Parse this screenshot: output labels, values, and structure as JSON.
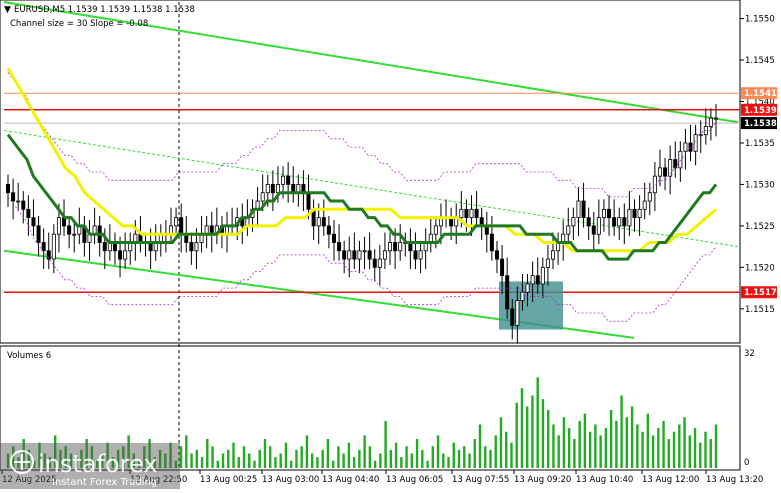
{
  "header": {
    "symbol_line": "EURUSD,M5  1.1539 1.1539 1.1538 1.1538",
    "indicator_line": "Channel size = 30 Slope = -0.08"
  },
  "volumes_panel": {
    "label": "Volumes 6",
    "scale_top": "32",
    "scale_bottom": "0"
  },
  "watermark": {
    "brand": "instaforex",
    "tagline": "Instant Forex Trading"
  },
  "colors": {
    "channel": "#33dd33",
    "level": "#ee1111",
    "level_light": "#ff8855",
    "ma_fast": "#1f7a1f",
    "ma_slow": "#f2f200",
    "envelope": "#aa33cc",
    "candle": "#000000",
    "volume": "#22aa22",
    "highlight": "#3f8f8f"
  },
  "chart_data": {
    "type": "candlestick",
    "symbol": "EURUSD",
    "timeframe": "M5",
    "ylim": [
      1.1511,
      1.1552
    ],
    "y_ticks": [
      "1.1550",
      "1.1545",
      "1.1540",
      "1.1535",
      "1.1530",
      "1.1525",
      "1.1520",
      "1.1515"
    ],
    "x_ticks": [
      "12 Aug 2025",
      "12 Aug 22:50",
      "13 Aug 00:25",
      "13 Aug 03:00",
      "13 Aug 04:40",
      "13 Aug 06:05",
      "13 Aug 07:55",
      "13 Aug 09:20",
      "13 Aug 10:40",
      "13 Aug 12:00",
      "13 Aug 13:20"
    ],
    "levels": [
      {
        "value": 1.1541,
        "label": "1.1541",
        "style": "light"
      },
      {
        "value": 1.1539,
        "label": "1.1539",
        "style": "strong"
      },
      {
        "value": 1.1517,
        "label": "1.1517",
        "style": "strong"
      }
    ],
    "current_price": {
      "value": 1.1538,
      "label": "1.1538"
    },
    "close": [
      1.1529,
      1.1528,
      1.1528,
      1.1527,
      1.1526,
      1.1525,
      1.1523,
      1.1522,
      1.1521,
      1.1524,
      1.1526,
      1.1525,
      1.1524,
      1.1524,
      1.1525,
      1.1523,
      1.1524,
      1.1525,
      1.1523,
      1.1522,
      1.1523,
      1.1522,
      1.1521,
      1.1522,
      1.1523,
      1.1524,
      1.1523,
      1.1523,
      1.1522,
      1.1523,
      1.1524,
      1.1524,
      1.1525,
      1.1526,
      1.1524,
      1.1523,
      1.1522,
      1.1523,
      1.1524,
      1.1525,
      1.1524,
      1.1525,
      1.1524,
      1.1525,
      1.1525,
      1.1526,
      1.1525,
      1.1526,
      1.1527,
      1.1528,
      1.1529,
      1.153,
      1.1529,
      1.153,
      1.1531,
      1.153,
      1.1529,
      1.153,
      1.1529,
      1.1527,
      1.1525,
      1.1526,
      1.1525,
      1.1524,
      1.1523,
      1.1522,
      1.1521,
      1.1522,
      1.1521,
      1.1522,
      1.1522,
      1.1521,
      1.152,
      1.1521,
      1.1522,
      1.1523,
      1.1522,
      1.1523,
      1.1523,
      1.1522,
      1.1521,
      1.1522,
      1.1523,
      1.1524,
      1.1525,
      1.1526,
      1.1526,
      1.1525,
      1.1526,
      1.1527,
      1.1526,
      1.1527,
      1.1526,
      1.1525,
      1.1524,
      1.1522,
      1.1521,
      1.1519,
      1.1515,
      1.1513,
      1.1516,
      1.1517,
      1.1518,
      1.1519,
      1.1518,
      1.152,
      1.1521,
      1.1522,
      1.1523,
      1.1524,
      1.1525,
      1.1526,
      1.1528,
      1.1526,
      1.1525,
      1.1524,
      1.1526,
      1.1527,
      1.1526,
      1.1525,
      1.1526,
      1.1525,
      1.1527,
      1.1526,
      1.1527,
      1.1528,
      1.1529,
      1.1531,
      1.1532,
      1.1531,
      1.1533,
      1.1532,
      1.1534,
      1.1535,
      1.1534,
      1.1536,
      1.1536,
      1.1537,
      1.1538,
      1.1538
    ],
    "ma_fast": [
      1.1536,
      1.1535,
      1.1534,
      1.1533,
      1.1531,
      1.153,
      1.1529,
      1.1528,
      1.1527,
      1.1526,
      1.1526,
      1.1525,
      1.1525,
      1.1524,
      1.1524,
      1.1524,
      1.1523,
      1.1523,
      1.1523,
      1.1523,
      1.1523,
      1.1523,
      1.1523,
      1.1523,
      1.1523,
      1.1523,
      1.1523,
      1.1524,
      1.1524,
      1.1524,
      1.1524,
      1.1524,
      1.1524,
      1.1524,
      1.1525,
      1.1525,
      1.1525,
      1.1526,
      1.1526,
      1.1527,
      1.1527,
      1.1528,
      1.1528,
      1.1529,
      1.1529,
      1.1529,
      1.1529,
      1.1529,
      1.1529,
      1.1529,
      1.1529,
      1.1528,
      1.1528,
      1.1528,
      1.1527,
      1.1527,
      1.1527,
      1.1526,
      1.1526,
      1.1525,
      1.1525,
      1.1524,
      1.1524,
      1.1523,
      1.1523,
      1.1523,
      1.1523,
      1.1523,
      1.1523,
      1.1524,
      1.1524,
      1.1524,
      1.1524,
      1.1524,
      1.1525,
      1.1525,
      1.1525,
      1.1525,
      1.1525,
      1.1525,
      1.1525,
      1.1525,
      1.1524,
      1.1524,
      1.1524,
      1.1524,
      1.1524,
      1.1523,
      1.1523,
      1.1523,
      1.1522,
      1.1522,
      1.1522,
      1.1522,
      1.1522,
      1.1521,
      1.1521,
      1.1521,
      1.1521,
      1.1522,
      1.1522,
      1.1522,
      1.1522,
      1.1523,
      1.1523,
      1.1524,
      1.1525,
      1.1526,
      1.1527,
      1.1528,
      1.1529,
      1.1529,
      1.153
    ],
    "ma_slow": [
      1.1544,
      1.1542,
      1.154,
      1.1538,
      1.1536,
      1.1534,
      1.1532,
      1.1531,
      1.1529,
      1.1528,
      1.1527,
      1.1526,
      1.1525,
      1.1525,
      1.1524,
      1.1524,
      1.1524,
      1.1524,
      1.1524,
      1.1524,
      1.1524,
      1.1524,
      1.1524,
      1.1524,
      1.1524,
      1.1525,
      1.1525,
      1.1525,
      1.1525,
      1.1526,
      1.1526,
      1.1526,
      1.1527,
      1.1527,
      1.1527,
      1.1527,
      1.1527,
      1.1527,
      1.1527,
      1.1527,
      1.1527,
      1.1526,
      1.1526,
      1.1526,
      1.1526,
      1.1526,
      1.1526,
      1.1526,
      1.1525,
      1.1525,
      1.1525,
      1.1525,
      1.1525,
      1.1524,
      1.1524,
      1.1524,
      1.1523,
      1.1523,
      1.1523,
      1.1522,
      1.1522,
      1.1522,
      1.1522,
      1.1522,
      1.1522,
      1.1522,
      1.1522,
      1.1523,
      1.1523,
      1.1523,
      1.1524,
      1.1524,
      1.1525,
      1.1526,
      1.1527
    ],
    "volumes": [
      4,
      6,
      3,
      8,
      5,
      2,
      7,
      4,
      3,
      9,
      5,
      6,
      4,
      3,
      5,
      8,
      6,
      2,
      4,
      7,
      3,
      5,
      6,
      9,
      4,
      2,
      6,
      8,
      3,
      5,
      4,
      7,
      2,
      6,
      9,
      4,
      5,
      3,
      8,
      6,
      2,
      4,
      5,
      7,
      3,
      6,
      4,
      2,
      5,
      8,
      6,
      3,
      4,
      7,
      2,
      5,
      6,
      9,
      4,
      3,
      5,
      8,
      2,
      6,
      4,
      7,
      3,
      5,
      9,
      6,
      2,
      4,
      13,
      5,
      7,
      3,
      6,
      4,
      8,
      5,
      2,
      6,
      9,
      4,
      3,
      7,
      5,
      6,
      4,
      8,
      12,
      6,
      5,
      9,
      14,
      10,
      7,
      18,
      22,
      17,
      20,
      25,
      19,
      16,
      12,
      9,
      14,
      11,
      8,
      13,
      15,
      10,
      12,
      9,
      11,
      16,
      13,
      20,
      14,
      17,
      12,
      10,
      15,
      9,
      11,
      13,
      8,
      10,
      12,
      14,
      9,
      11,
      7,
      10,
      8,
      12
    ]
  }
}
